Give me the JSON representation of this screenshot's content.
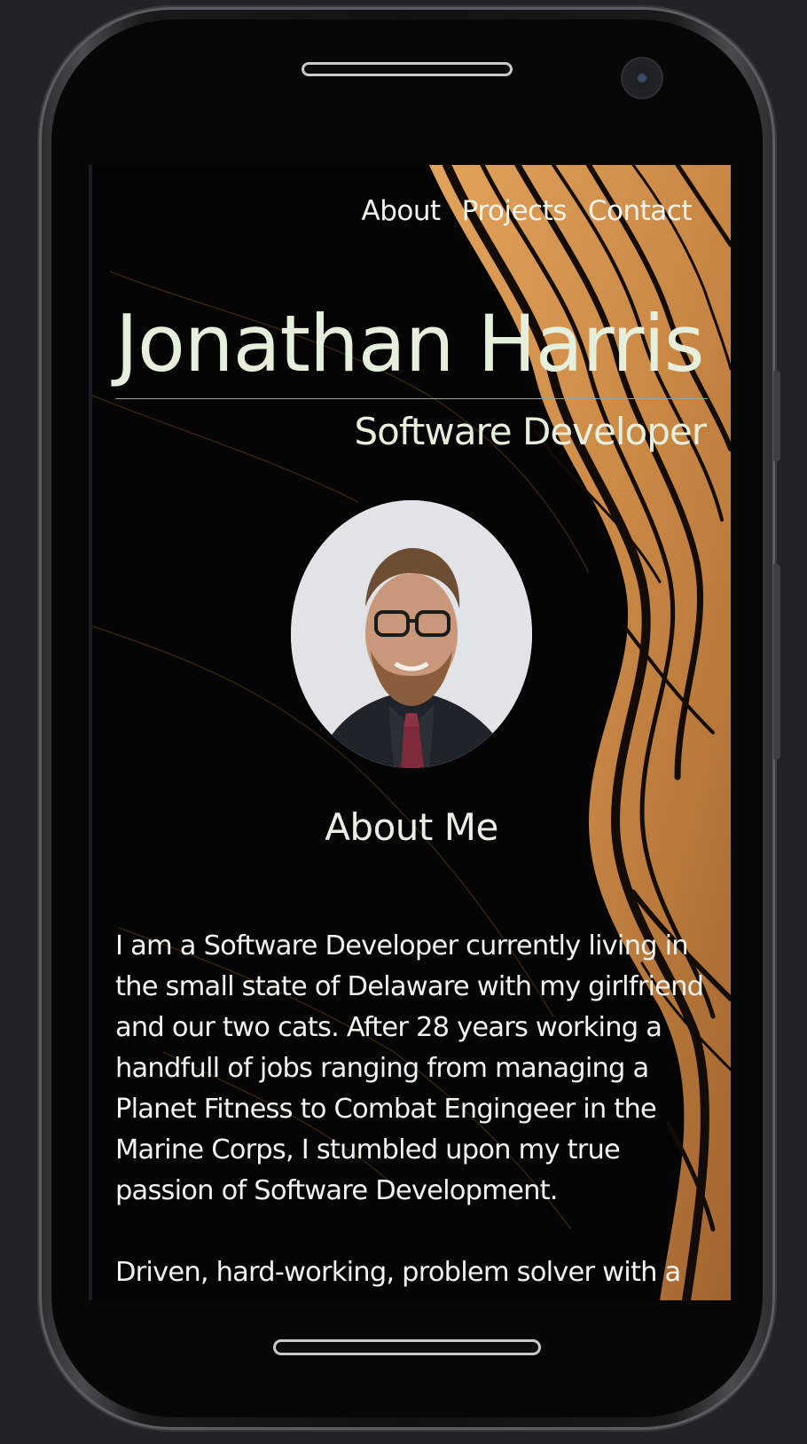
{
  "nav": {
    "items": [
      "About",
      "Projects",
      "Contact"
    ]
  },
  "hero": {
    "name": "Jonathan Harris",
    "role": "Software Developer"
  },
  "about": {
    "title": "About Me",
    "paragraphs": [
      "I am a Software Developer currently living in the small state of Delaware with my girlfriend and our two cats. After 28 years working a handfull of jobs ranging from managing a Planet Fitness to Combat Engingeer in the Marine Corps, I stumbled upon my true passion of Software Development.",
      "Driven, hard-working, problem solver with a high"
    ]
  },
  "colors": {
    "background": "#060606",
    "accent_marble": "#d8984f",
    "text": "#e8efe0"
  }
}
